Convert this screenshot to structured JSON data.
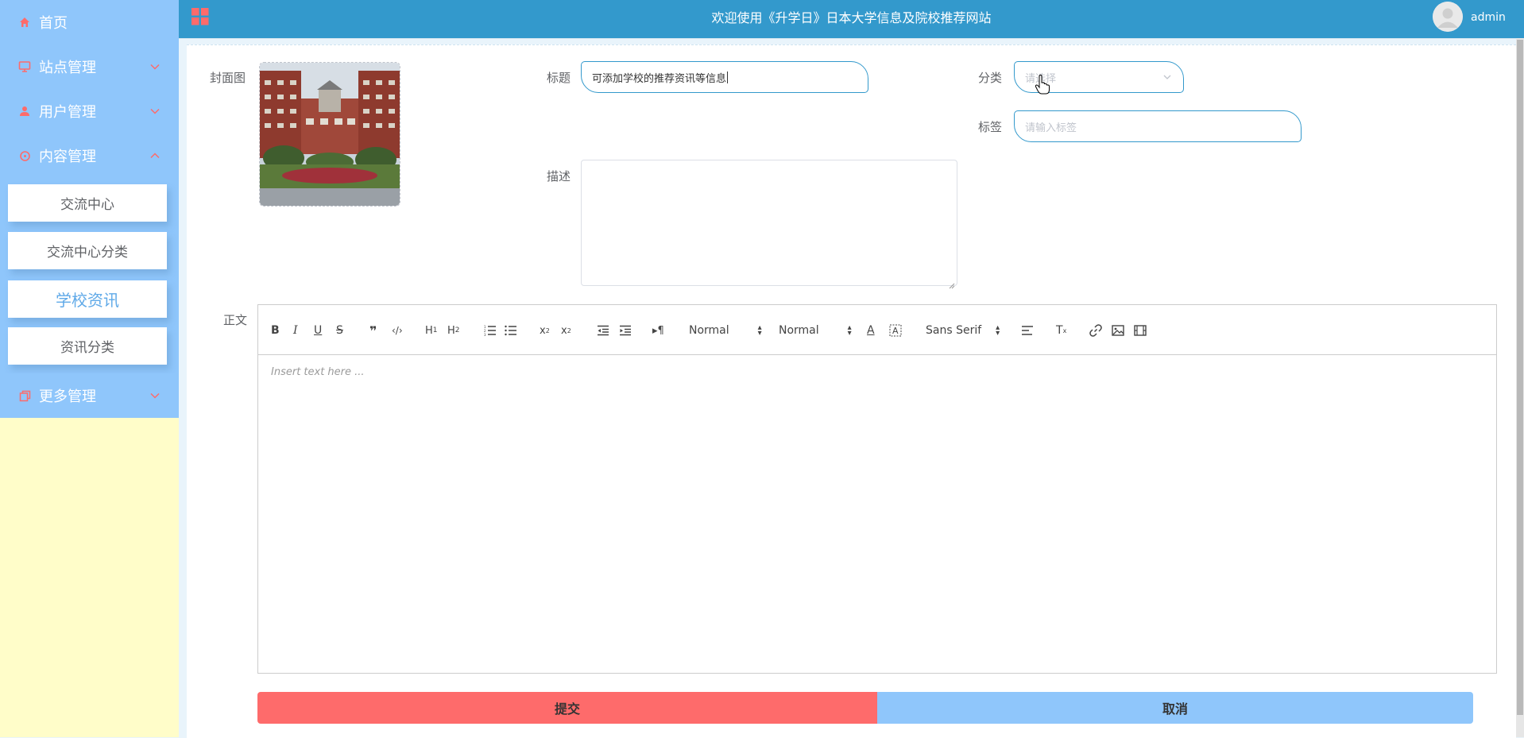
{
  "header": {
    "title": "欢迎使用《升学日》日本大学信息及院校推荐网站",
    "username": "admin",
    "grid_icon_color": "#fe6b6b"
  },
  "sidebar": {
    "items": [
      {
        "label": "首页",
        "icon": "home-icon"
      },
      {
        "label": "站点管理",
        "icon": "monitor-icon"
      },
      {
        "label": "用户管理",
        "icon": "user-icon"
      },
      {
        "label": "内容管理",
        "icon": "chat-icon"
      },
      {
        "label": "更多管理",
        "icon": "copy-icon"
      }
    ],
    "subitems": [
      {
        "label": "交流中心"
      },
      {
        "label": "交流中心分类"
      },
      {
        "label": "学校资讯"
      },
      {
        "label": "资讯分类"
      }
    ],
    "active_subitem": "学校资讯"
  },
  "form": {
    "cover_label": "封面图",
    "title_label": "标题",
    "title_value": "可添加学校的推荐资讯等信息",
    "category_label": "分类",
    "category_placeholder": "请选择",
    "tag_label": "标签",
    "tag_placeholder": "请输入标签",
    "desc_label": "描述",
    "body_label": "正文"
  },
  "editor": {
    "placeholder": "Insert text here ...",
    "header_select": "Normal",
    "size_select": "Normal",
    "font_select": "Sans Serif"
  },
  "buttons": {
    "submit": "提交",
    "cancel": "取消"
  },
  "colors": {
    "accent": "#3399cc",
    "sidebar": "#8fc6fb",
    "sidebar_bg": "#fffdc9",
    "icon_red": "#fe6b6b",
    "submit": "#fe6b6b",
    "cancel": "#8fc6fb"
  }
}
